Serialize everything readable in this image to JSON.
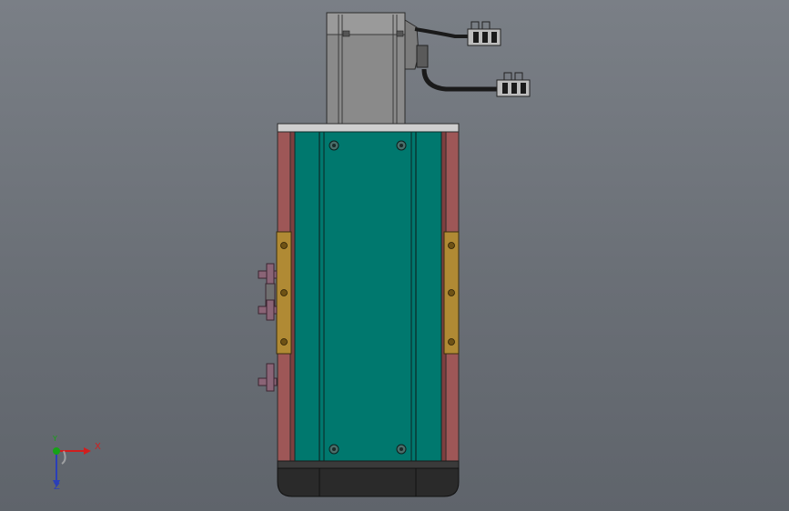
{
  "viewport": {
    "background_top": "#7a7f86",
    "background_bottom": "#5f646b"
  },
  "colors": {
    "carriage_teal": "#00786e",
    "rail_red": "#9e5757",
    "clamp_gold": "#b08a34",
    "motor_grey": "#878787",
    "end_cap_dark": "#2a2a2a",
    "cable_black": "#1a1a1a",
    "connector_purple": "#8a6476"
  },
  "icons": [
    "view-triad-icon"
  ],
  "triad": {
    "x_label": "X",
    "y_label": "Y",
    "z_label": "Z",
    "x_color": "#d21e1e",
    "y_color": "#16a216",
    "z_color": "#2a3fb8"
  }
}
